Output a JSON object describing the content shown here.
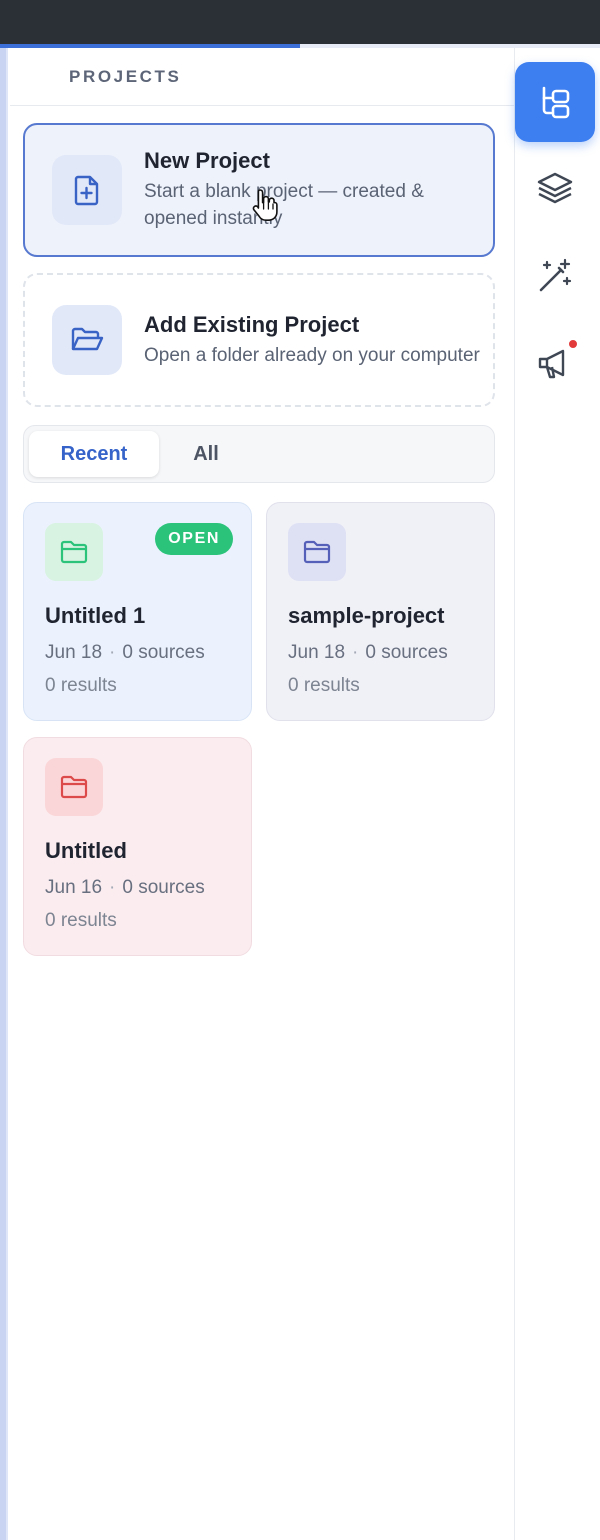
{
  "sidebar": {
    "header": {
      "title": "PROJECTS"
    },
    "progress": {
      "fraction": 0.5
    }
  },
  "actions": {
    "new_project": {
      "title": "New Project",
      "description": "Start a blank project — created & opened instantly"
    },
    "add_existing": {
      "title": "Add Existing Project",
      "description": "Open a folder already on your computer"
    }
  },
  "tabs": [
    {
      "label": "Recent",
      "active": true
    },
    {
      "label": "All",
      "active": false
    }
  ],
  "projects": [
    {
      "name": "Untitled 1",
      "date": "Jun 18",
      "sources": "0 sources",
      "results": "0 results",
      "badge": "OPEN",
      "color": "#2bc37a"
    },
    {
      "name": "sample-project",
      "date": "Jun 18",
      "sources": "0 sources",
      "results": "0 results",
      "color": "#5560b8"
    },
    {
      "name": "Untitled",
      "date": "Jun 16",
      "sources": "0 sources",
      "results": "0 results",
      "color": "#dd4a4a"
    }
  ],
  "rail": {
    "items": [
      {
        "icon": "project-tree-icon",
        "active": true
      },
      {
        "icon": "layers-icon",
        "active": false
      },
      {
        "icon": "magic-wand-icon",
        "active": false
      },
      {
        "icon": "megaphone-icon",
        "active": false,
        "notification": true
      }
    ]
  },
  "colors": {
    "accent": "#3d7ef0",
    "open_badge": "#2bc37a"
  }
}
